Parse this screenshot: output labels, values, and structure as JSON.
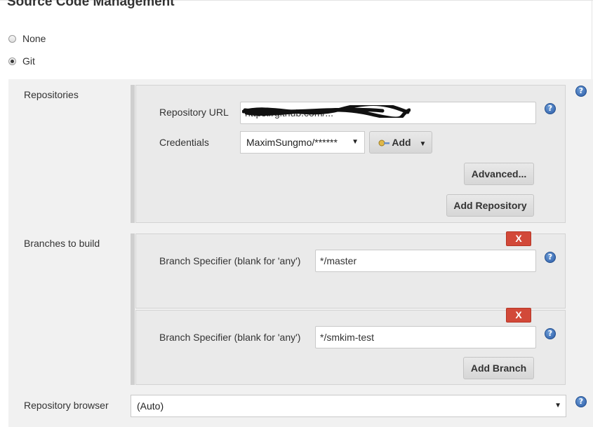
{
  "section": {
    "title": "Source Code Management"
  },
  "scm_options": [
    {
      "label": "None",
      "selected": false
    },
    {
      "label": "Git",
      "selected": true
    }
  ],
  "repositories": {
    "label": "Repositories",
    "url_label": "Repository URL",
    "url_value": "https://github.com/...",
    "credentials_label": "Credentials",
    "credentials_value": "MaximSungmo/******",
    "add_button_label": "Add",
    "advanced_button_label": "Advanced...",
    "add_repository_button_label": "Add Repository"
  },
  "branches": {
    "label": "Branches to build",
    "specifier_label": "Branch Specifier (blank for 'any')",
    "items": [
      {
        "value": "*/master"
      },
      {
        "value": "*/smkim-test"
      }
    ],
    "delete_label": "X",
    "add_branch_button_label": "Add Branch"
  },
  "repository_browser": {
    "label": "Repository browser",
    "value": "(Auto)"
  },
  "help_icon_glyph": "?",
  "colors": {
    "panel_bg": "#f1f1f1",
    "box_bg": "#eaeaea",
    "delete_red": "#d24939",
    "help_blue": "#2a5aa6"
  }
}
